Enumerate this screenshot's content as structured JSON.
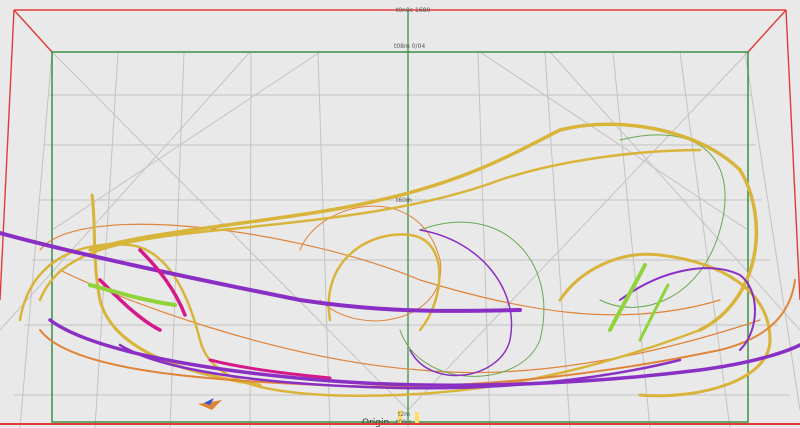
{
  "view": {
    "background": "#e9e9e9",
    "outer_box_color": "#e23a3a",
    "inner_box_color": "#2e8b3a",
    "axis_color": "#2e8b3a",
    "grid_color": "#bdbdbd"
  },
  "labels": {
    "top_outer": "t0n0c 1680",
    "top_inner": "t08m 0/04",
    "mid": "t60m",
    "origin": "Origin",
    "origin_scale": "t00m",
    "origin_scale2": "t2m"
  },
  "tracks": [
    {
      "name": "yellow",
      "color": "#d9b43a"
    },
    {
      "name": "orange",
      "color": "#e0843a"
    },
    {
      "name": "purple",
      "color": "#8a2fc4"
    },
    {
      "name": "magenta",
      "color": "#d41a8a"
    },
    {
      "name": "green",
      "color": "#8fd43a"
    },
    {
      "name": "thin-green",
      "color": "#6aa84f"
    }
  ]
}
